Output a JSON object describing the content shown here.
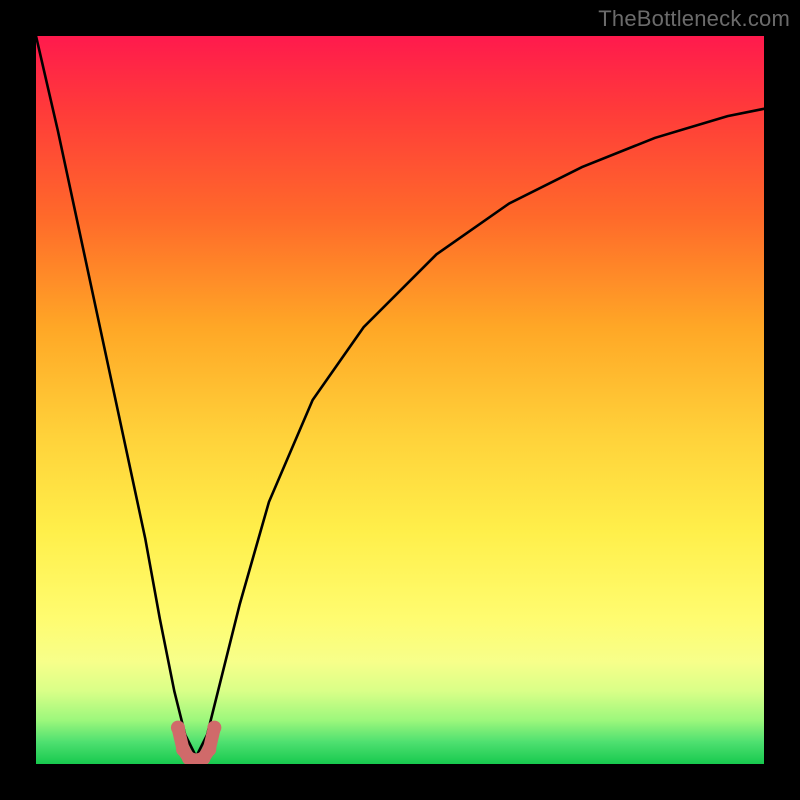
{
  "watermark": "TheBottleneck.com",
  "chart_data": {
    "type": "line",
    "title": "",
    "xlabel": "",
    "ylabel": "",
    "xlim": [
      0,
      100
    ],
    "ylim": [
      0,
      100
    ],
    "series": [
      {
        "name": "bottleneck-curve",
        "x": [
          0,
          3,
          6,
          9,
          12,
          15,
          17,
          19,
          20.5,
          22,
          23.5,
          25,
          28,
          32,
          38,
          45,
          55,
          65,
          75,
          85,
          95,
          100
        ],
        "y": [
          100,
          87,
          73,
          59,
          45,
          31,
          20,
          10,
          4,
          1,
          4,
          10,
          22,
          36,
          50,
          60,
          70,
          77,
          82,
          86,
          89,
          90
        ]
      }
    ],
    "marker_segment": {
      "name": "min-highlight",
      "color": "#d06a6a",
      "x": [
        19.5,
        20.2,
        21,
        22,
        23,
        23.8,
        24.5
      ],
      "y": [
        5,
        2,
        0.8,
        0.5,
        0.8,
        2,
        5
      ]
    }
  }
}
